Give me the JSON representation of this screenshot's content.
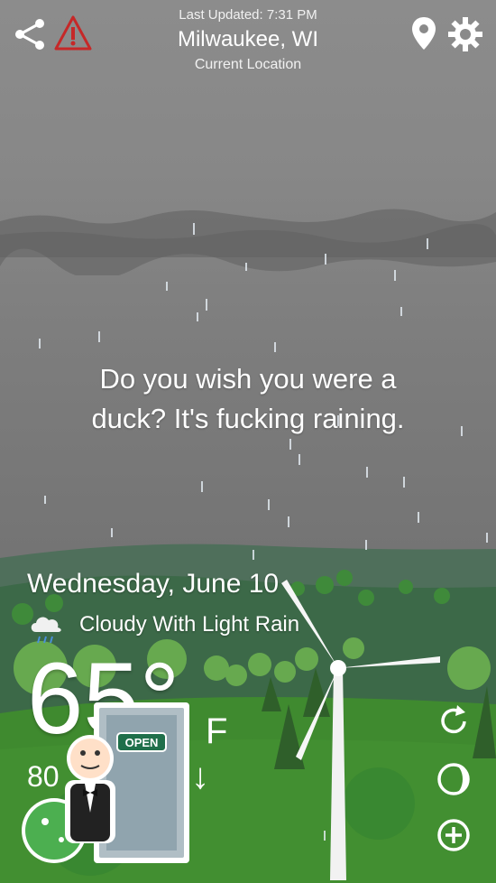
{
  "header": {
    "last_updated": "Last Updated: 7:31 PM",
    "city": "Milwaukee, WI",
    "location_label": "Current Location"
  },
  "message": {
    "line1": "Do you wish you were a",
    "line2": "duck? It's fucking raining."
  },
  "forecast": {
    "date": "Wednesday, June 10",
    "condition": "Cloudy With Light Rain",
    "temperature": "65°",
    "unit": "F",
    "high_partial": "80",
    "trend_arrow": "↓"
  },
  "mascot": {
    "sign_text": "OPEN"
  },
  "icons": {
    "share": "share-icon",
    "alert": "alert-icon",
    "location": "location-pin-icon",
    "settings": "gear-icon",
    "refresh": "refresh-icon",
    "moon": "moon-phase-icon",
    "add": "plus-icon"
  },
  "colors": {
    "alert_red": "#c62828",
    "grass": "#3f8a2f",
    "sky": "#878787"
  }
}
